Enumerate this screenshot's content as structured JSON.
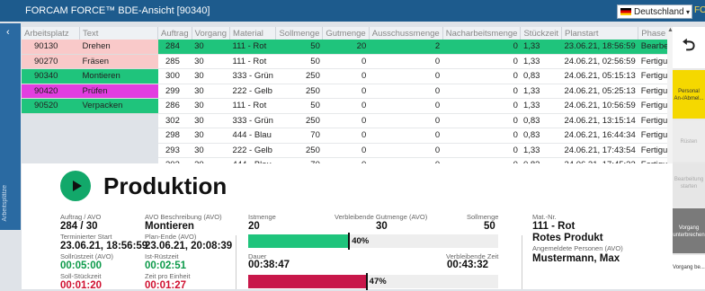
{
  "window": {
    "title": "FORCAM FORCE™ BDE-Ansicht [90340]",
    "language": "Deutschland",
    "right_hint": "FO"
  },
  "sidebar": {
    "label": "Arbeitsplätze"
  },
  "workstations": {
    "headers": [
      "Arbeitsplatz",
      "Text"
    ],
    "rows": [
      {
        "id": "90130",
        "text": "Drehen",
        "bg": "#f9c9c9",
        "selected": false
      },
      {
        "id": "90270",
        "text": "Fräsen",
        "bg": "#f9c9c9",
        "selected": false
      },
      {
        "id": "90340",
        "text": "Montieren",
        "bg": "#1fc47c",
        "selected": true
      },
      {
        "id": "90420",
        "text": "Prüfen",
        "bg": "#e23ee0",
        "selected": false
      },
      {
        "id": "90520",
        "text": "Verpacken",
        "bg": "#1fc47c",
        "selected": false
      }
    ]
  },
  "orders": {
    "headers": [
      "Auftrag",
      "Vorgang",
      "Material",
      "Sollmenge",
      "Gutmenge",
      "Ausschussmenge",
      "Nacharbeitsmenge",
      "Stückzeit",
      "Planstart",
      "Phase"
    ],
    "rows": [
      [
        "284",
        "30",
        "111 - Rot",
        "50",
        "20",
        "2",
        "0",
        "1,33",
        "23.06.21, 18:56:59",
        "Bearbeitung"
      ],
      [
        "285",
        "30",
        "111 - Rot",
        "50",
        "0",
        "0",
        "0",
        "1,33",
        "24.06.21, 02:56:59",
        "Fertigungsbere"
      ],
      [
        "300",
        "30",
        "333 - Grün",
        "250",
        "0",
        "0",
        "0",
        "0,83",
        "24.06.21, 05:15:13",
        "Fertigungsbere"
      ],
      [
        "299",
        "30",
        "222 - Gelb",
        "250",
        "0",
        "0",
        "0",
        "1,33",
        "24.06.21, 05:25:13",
        "Fertigungsbere"
      ],
      [
        "286",
        "30",
        "111 - Rot",
        "50",
        "0",
        "0",
        "0",
        "1,33",
        "24.06.21, 10:56:59",
        "Fertigungsbere"
      ],
      [
        "302",
        "30",
        "333 - Grün",
        "250",
        "0",
        "0",
        "0",
        "0,83",
        "24.06.21, 13:15:14",
        "Fertigungsbere"
      ],
      [
        "298",
        "30",
        "444 - Blau",
        "70",
        "0",
        "0",
        "0",
        "0,83",
        "24.06.21, 16:44:34",
        "Fertigungsbere"
      ],
      [
        "293",
        "30",
        "222 - Gelb",
        "250",
        "0",
        "0",
        "0",
        "1,33",
        "24.06.21, 17:43:54",
        "Fertigungsbere"
      ],
      [
        "303",
        "30",
        "444 - Blau",
        "70",
        "0",
        "0",
        "0",
        "0,83",
        "24.06.21, 17:45:33",
        "Fertigungsbere"
      ]
    ],
    "active_row_color": "#1fc47c"
  },
  "right_panel": {
    "back_glyph": "⮌",
    "btn_person": "Personal An-/Abmel...",
    "btn_ruesten": "Rüsten",
    "btn_bearbeitung": "Bearbeitung starten",
    "btn_vorgang_unterbrechen": "Vorgang unterbrechen",
    "btn_vorgang_be": "Vorgang be..."
  },
  "status": {
    "title": "Produktion",
    "color": "#12a86a"
  },
  "details": {
    "auftrag_avo_label": "Auftrag / AVO",
    "auftrag_avo": "284 / 30",
    "avo_beschr_label": "AVO Beschreibung (AVO)",
    "avo_beschr": "Montieren",
    "term_start_label": "Terminierter Start",
    "term_start": "23.06.21, 18:56:59",
    "plan_ende_label": "Plan-Ende (AVO)",
    "plan_ende": "23.06.21, 20:08:39",
    "soll_ruest_label": "Sollrüstzeit (AVO)",
    "soll_ruest": "00:05:00",
    "ist_ruest_label": "Ist-Rüstzeit",
    "ist_ruest": "00:02:51",
    "soll_stueck_label": "Soll-Stückzeit",
    "soll_stueck": "00:01:20",
    "zeit_einheit_label": "Zeit pro Einheit",
    "zeit_einheit": "00:01:27"
  },
  "progress": {
    "ist_label": "Istmenge",
    "ist": "20",
    "rest_label": "Verbleibende Gutmenge (AVO)",
    "rest": "30",
    "soll_label": "Sollmenge",
    "soll": "50",
    "qty_percent": 40,
    "qty_text": "40%",
    "qty_color": "#1fc47c",
    "dauer_label": "Dauer",
    "dauer": "00:38:47",
    "rest_zeit_label": "Verbleibende Zeit",
    "rest_zeit": "00:43:32",
    "time_percent": 47,
    "time_text": "47%",
    "time_color": "#c8174a"
  },
  "material": {
    "label": "Mat.-Nr.",
    "nr": "111 - Rot",
    "name": "Rotes Produkt",
    "persons_label": "Angemeldete Personen (AVO)",
    "persons": "Mustermann, Max"
  }
}
